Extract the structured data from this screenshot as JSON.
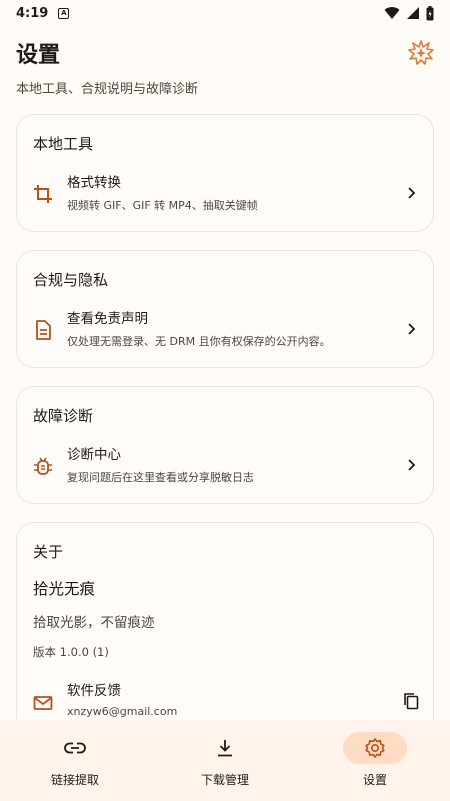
{
  "status_bar": {
    "time": "4:19",
    "notification_glyph": "A"
  },
  "header": {
    "title": "设置",
    "subtitle": "本地工具、合规说明与故障诊断",
    "icon": "sparkle-badge-icon"
  },
  "cards": {
    "local_tools": {
      "title": "本地工具",
      "item": {
        "label": "格式转换",
        "description": "视频转 GIF、GIF 转 MP4、抽取关键帧",
        "icon": "crop-icon"
      }
    },
    "compliance": {
      "title": "合规与隐私",
      "item": {
        "label": "查看免责声明",
        "description": "仅处理无需登录、无 DRM 且你有权保存的公开内容。",
        "icon": "document-icon"
      }
    },
    "diagnostics": {
      "title": "故障诊断",
      "item": {
        "label": "诊断中心",
        "description": "复现问题后在这里查看或分享脱敏日志",
        "icon": "bug-icon"
      }
    },
    "about": {
      "title": "关于",
      "app_name": "拾光无痕",
      "slogan": "拾取光影，不留痕迹",
      "version": "版本 1.0.0 (1)",
      "feedback": {
        "label": "软件反馈",
        "email": "xnzyw6@gmail.com",
        "icon": "mail-icon",
        "action_icon": "copy-icon"
      }
    }
  },
  "bottom_nav": {
    "items": [
      {
        "label": "链接提取",
        "icon": "link-icon",
        "active": false
      },
      {
        "label": "下载管理",
        "icon": "download-icon",
        "active": false
      },
      {
        "label": "设置",
        "icon": "gear-icon",
        "active": true
      }
    ]
  },
  "colors": {
    "accent": "#B8501A",
    "background": "#FFFBF7",
    "nav_background": "#FFF4EC",
    "active_pill": "#FFDCC4"
  }
}
